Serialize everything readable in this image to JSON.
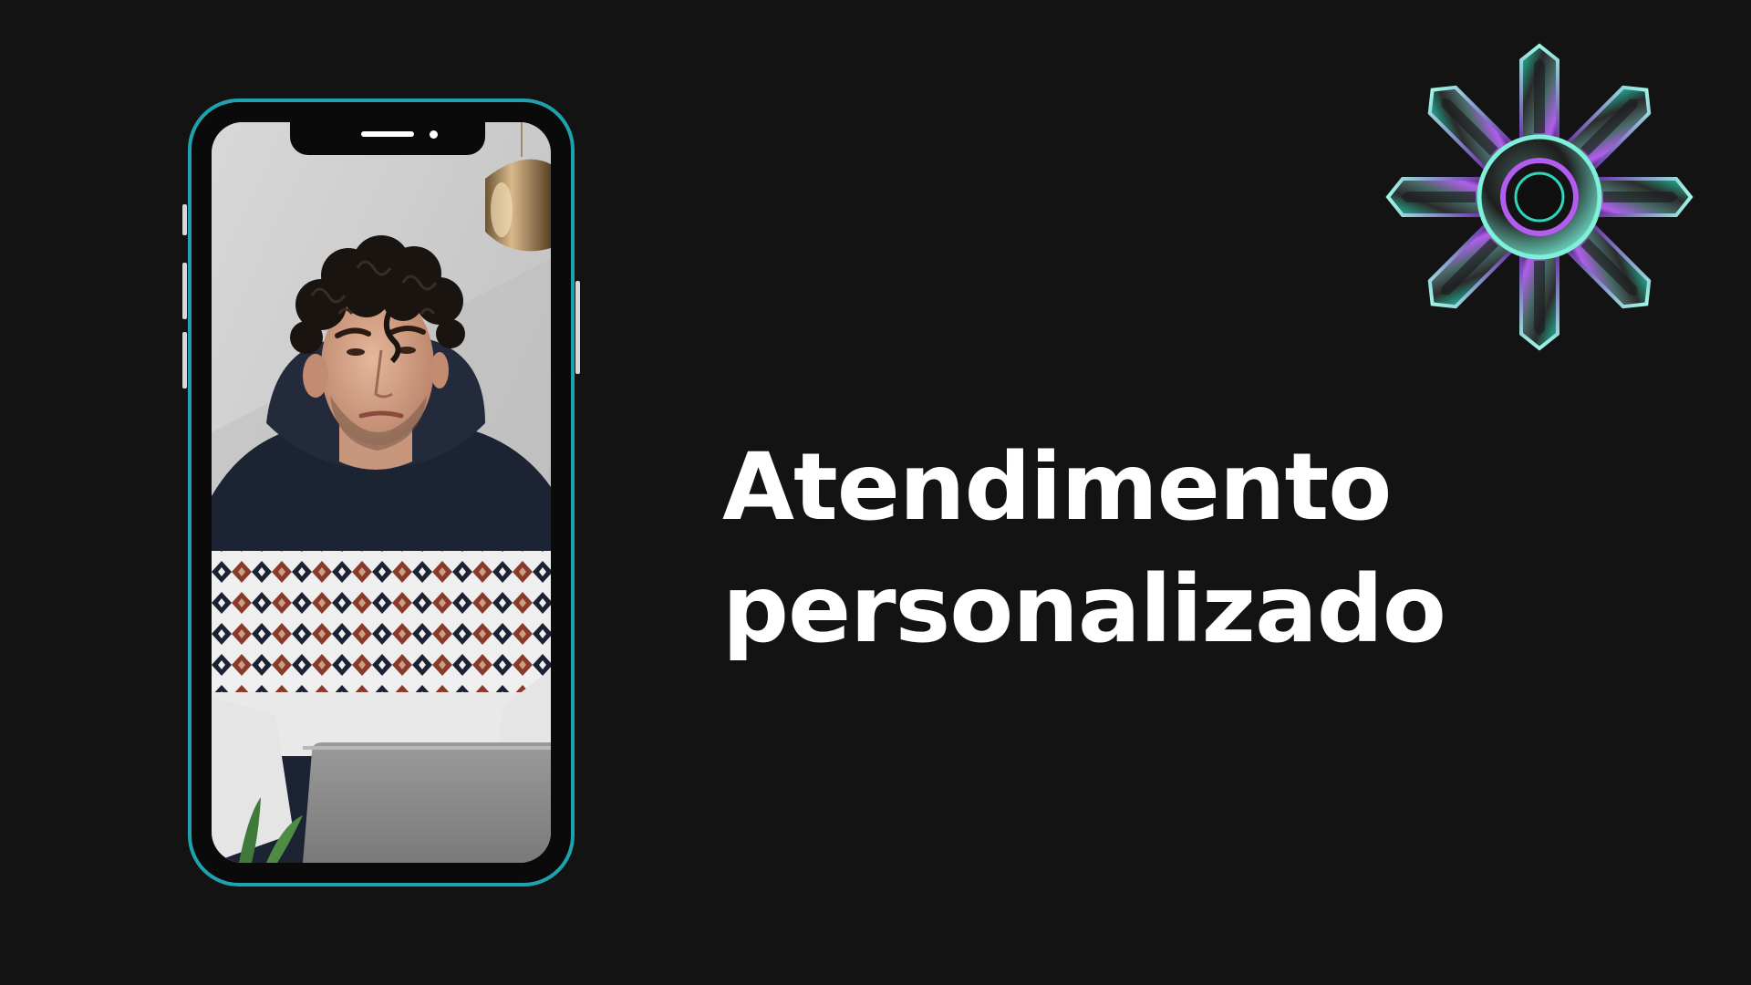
{
  "slide": {
    "headline_line1": "Atendimento",
    "headline_line2": "personalizado",
    "background_color": "#131313",
    "text_color": "#ffffff"
  },
  "phone": {
    "frame_color": "#1fa2ad",
    "photo": "person-at-laptop-image"
  },
  "decoration": {
    "icon": "iridescent-star-gear-icon",
    "colors": [
      "#1fd1b0",
      "#b45cf0",
      "#2a2a2a"
    ]
  }
}
